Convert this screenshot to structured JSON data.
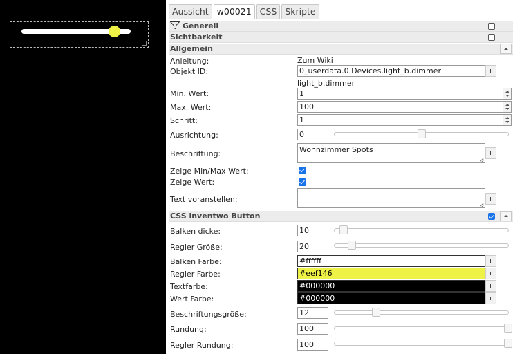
{
  "tabs": [
    "Aussicht",
    "w00021",
    "CSS",
    "Skripte"
  ],
  "sections": {
    "generell": "Generell",
    "sichtbarkeit": "Sichtbarkeit",
    "allgemein": "Allgemein",
    "css_inventwo": "CSS inventwo Button"
  },
  "fields": {
    "anleitung_label": "Anleitung:",
    "anleitung_link": "Zum Wiki",
    "objekt_id_label": "Objekt ID:",
    "objekt_id_value": "0_userdata.0.Devices.light_b.dimmer",
    "objekt_id_name": "light_b.dimmer",
    "min_label": "Min. Wert:",
    "min_value": "1",
    "max_label": "Max. Wert:",
    "max_value": "100",
    "schritt_label": "Schritt:",
    "schritt_value": "1",
    "ausrichtung_label": "Ausrichtung:",
    "ausrichtung_value": "0",
    "beschriftung_label": "Beschriftung:",
    "beschriftung_value": "Wohnzimmer Spots",
    "zeige_minmax_label": "Zeige Min/Max Wert:",
    "zeige_wert_label": "Zeige Wert:",
    "text_voranstellen_label": "Text voranstellen:",
    "balken_dicke_label": "Balken dicke:",
    "balken_dicke_value": "10",
    "regler_groesse_label": "Regler Größe:",
    "regler_groesse_value": "20",
    "balken_farbe_label": "Balken Farbe:",
    "balken_farbe_value": "#ffffff",
    "regler_farbe_label": "Regler Farbe:",
    "regler_farbe_value": "#eef146",
    "textfarbe_label": "Textfarbe:",
    "textfarbe_value": "#000000",
    "wert_farbe_label": "Wert Farbe:",
    "wert_farbe_value": "#000000",
    "beschriftungsgroesse_label": "Beschriftungsgröße:",
    "beschriftungsgroesse_value": "12",
    "rundung_label": "Rundung:",
    "rundung_value": "100",
    "regler_rundung_label": "Regler Rundung:",
    "regler_rundung_value": "100"
  },
  "sliders": {
    "ausrichtung": 0.5,
    "balken_dicke": 0.05,
    "regler_groesse": 0.1,
    "beschriftungsgroesse": 0.24,
    "rundung": 1.0,
    "regler_rundung": 1.0
  },
  "widget": {
    "slider_value_fraction": 0.85,
    "bar_color": "#ffffff",
    "knob_color": "#eef146"
  },
  "colors": {
    "accent": "#1a73e8",
    "swatch_yellow": "#eef146",
    "swatch_black": "#000000",
    "swatch_white": "#ffffff"
  }
}
